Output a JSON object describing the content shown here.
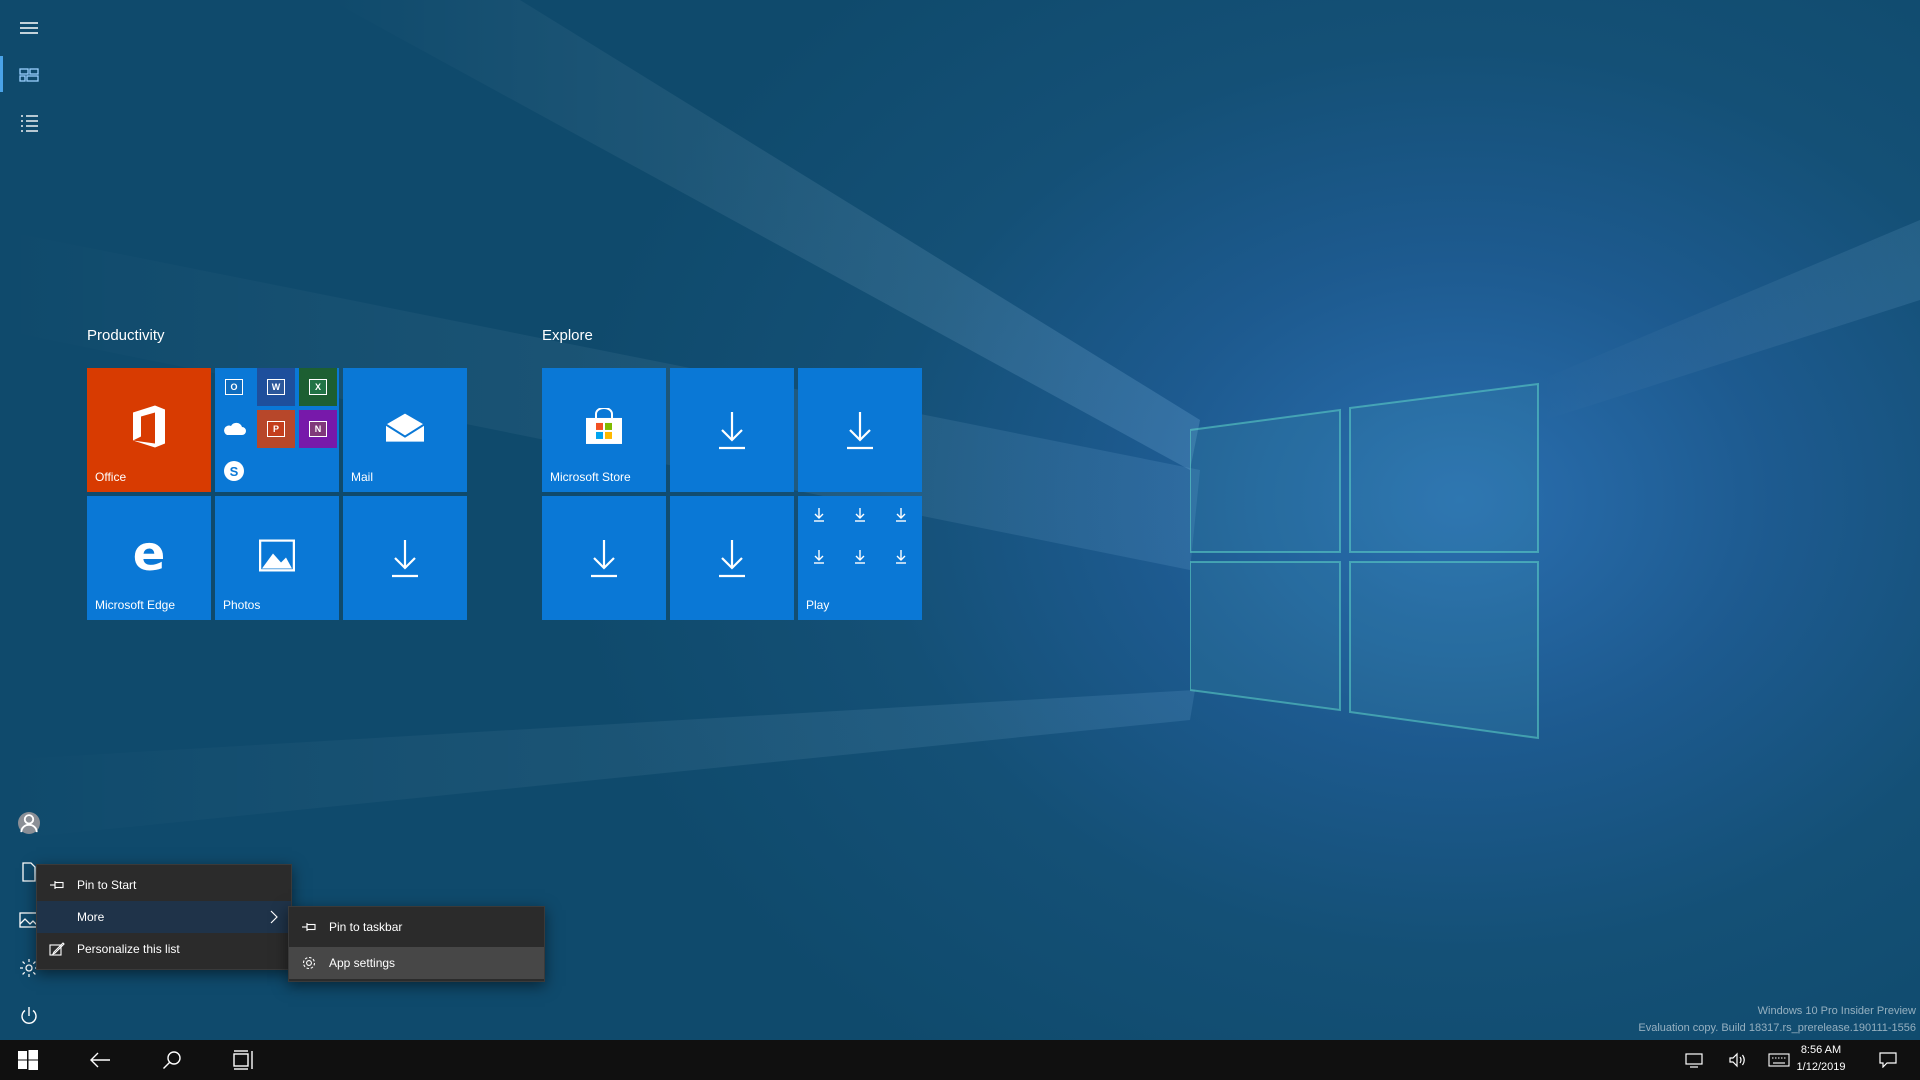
{
  "rail": {
    "items": [
      {
        "name": "expand-menu-icon"
      },
      {
        "name": "tiles-view-icon"
      },
      {
        "name": "all-apps-list-icon"
      },
      {
        "name": "user-avatar-icon"
      },
      {
        "name": "documents-icon"
      },
      {
        "name": "pictures-icon"
      },
      {
        "name": "settings-gear-icon"
      },
      {
        "name": "power-icon"
      }
    ]
  },
  "groups": [
    {
      "title": "Productivity",
      "tiles": [
        {
          "label": "Office",
          "icon": "office-icon",
          "color": "#d83b01"
        },
        {
          "label": "",
          "icon": "office-suite-folder",
          "apps": [
            "O",
            "W",
            "X",
            "cloud",
            "P",
            "N",
            "S"
          ]
        },
        {
          "label": "Mail",
          "icon": "mail-icon"
        },
        {
          "label": "Microsoft Edge",
          "icon": "edge-icon"
        },
        {
          "label": "Photos",
          "icon": "photos-icon"
        },
        {
          "label": "",
          "icon": "download-icon"
        }
      ]
    },
    {
      "title": "Explore",
      "tiles": [
        {
          "label": "Microsoft Store",
          "icon": "store-icon"
        },
        {
          "label": "",
          "icon": "download-icon"
        },
        {
          "label": "",
          "icon": "download-icon"
        },
        {
          "label": "",
          "icon": "download-icon"
        },
        {
          "label": "",
          "icon": "download-icon"
        },
        {
          "label": "Play",
          "icon": "play-folder"
        }
      ]
    }
  ],
  "context_menu": {
    "items": [
      {
        "label": "Pin to Start",
        "icon": "pin-icon"
      },
      {
        "label": "More",
        "icon": "",
        "has_submenu": true
      },
      {
        "label": "Personalize this list",
        "icon": "personalize-icon"
      }
    ]
  },
  "submenu": {
    "items": [
      {
        "label": "Pin to taskbar",
        "icon": "pin-taskbar-icon"
      },
      {
        "label": "App settings",
        "icon": "gear-icon"
      }
    ]
  },
  "watermark": {
    "line1": "Windows 10 Pro Insider Preview",
    "line2": "Evaluation copy. Build 18317.rs_prerelease.190111-1556"
  },
  "taskbar": {
    "time": "8:56 AM",
    "date": "1/12/2019"
  },
  "colors": {
    "tile_blue": "#0a78d6",
    "office_orange": "#d83b01",
    "menu_bg": "#2b2b2b",
    "taskbar_bg": "#101010"
  }
}
